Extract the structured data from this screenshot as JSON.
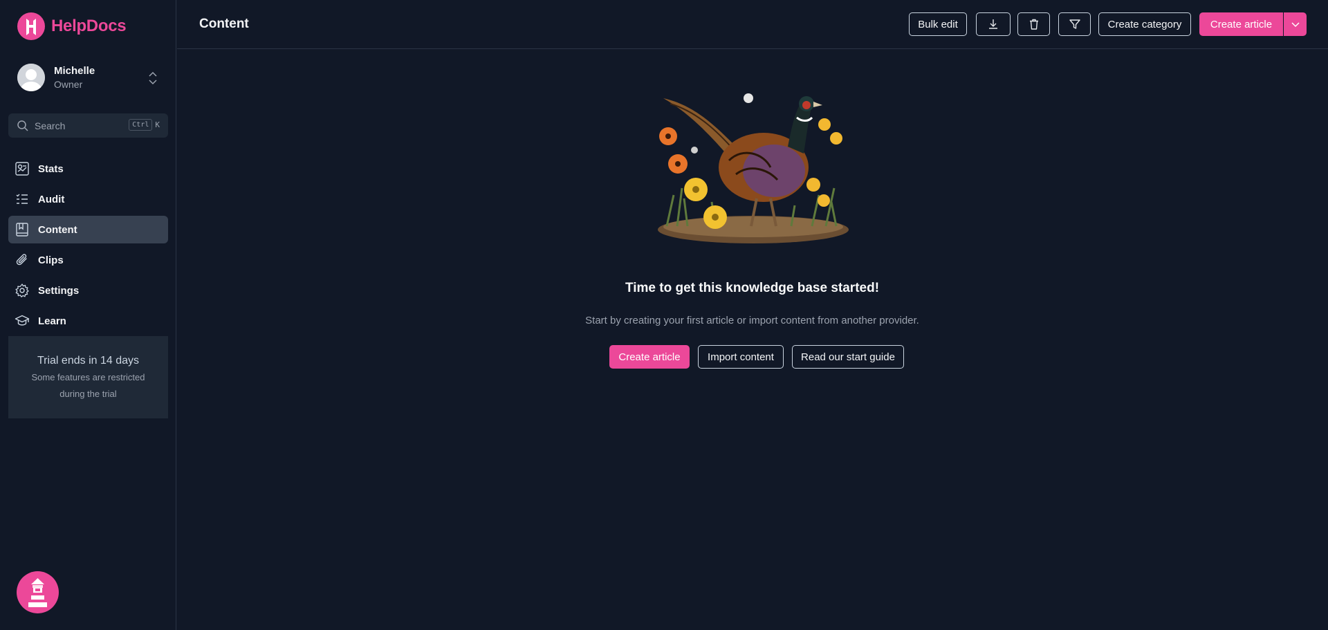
{
  "brand": {
    "name": "HelpDocs",
    "color": "#ec4899"
  },
  "user": {
    "name": "Michelle",
    "role": "Owner"
  },
  "search": {
    "placeholder": "Search",
    "shortcut_key": "Ctrl",
    "shortcut_letter": "K"
  },
  "sidebar": {
    "items": [
      {
        "label": "Stats",
        "icon": "stats-icon",
        "active": false
      },
      {
        "label": "Audit",
        "icon": "audit-list-icon",
        "active": false
      },
      {
        "label": "Content",
        "icon": "book-icon",
        "active": true
      },
      {
        "label": "Clips",
        "icon": "paperclip-icon",
        "active": false
      },
      {
        "label": "Settings",
        "icon": "gear-icon",
        "active": false
      },
      {
        "label": "Learn",
        "icon": "graduation-cap-icon",
        "active": false
      }
    ]
  },
  "trial": {
    "title": "Trial ends in 14 days",
    "subtitle": "Some features are restricted during the trial"
  },
  "header": {
    "title": "Content",
    "bulk_edit": "Bulk edit",
    "create_category": "Create category",
    "create_article": "Create article"
  },
  "empty_state": {
    "title": "Time to get this knowledge base started!",
    "subtitle": "Start by creating your first article or import content from another provider.",
    "create_article": "Create article",
    "import_content": "Import content",
    "read_guide": "Read our start guide"
  },
  "colors": {
    "background": "#111827",
    "panel": "#1f2937",
    "accent": "#ec4899",
    "active_nav": "#374151"
  }
}
